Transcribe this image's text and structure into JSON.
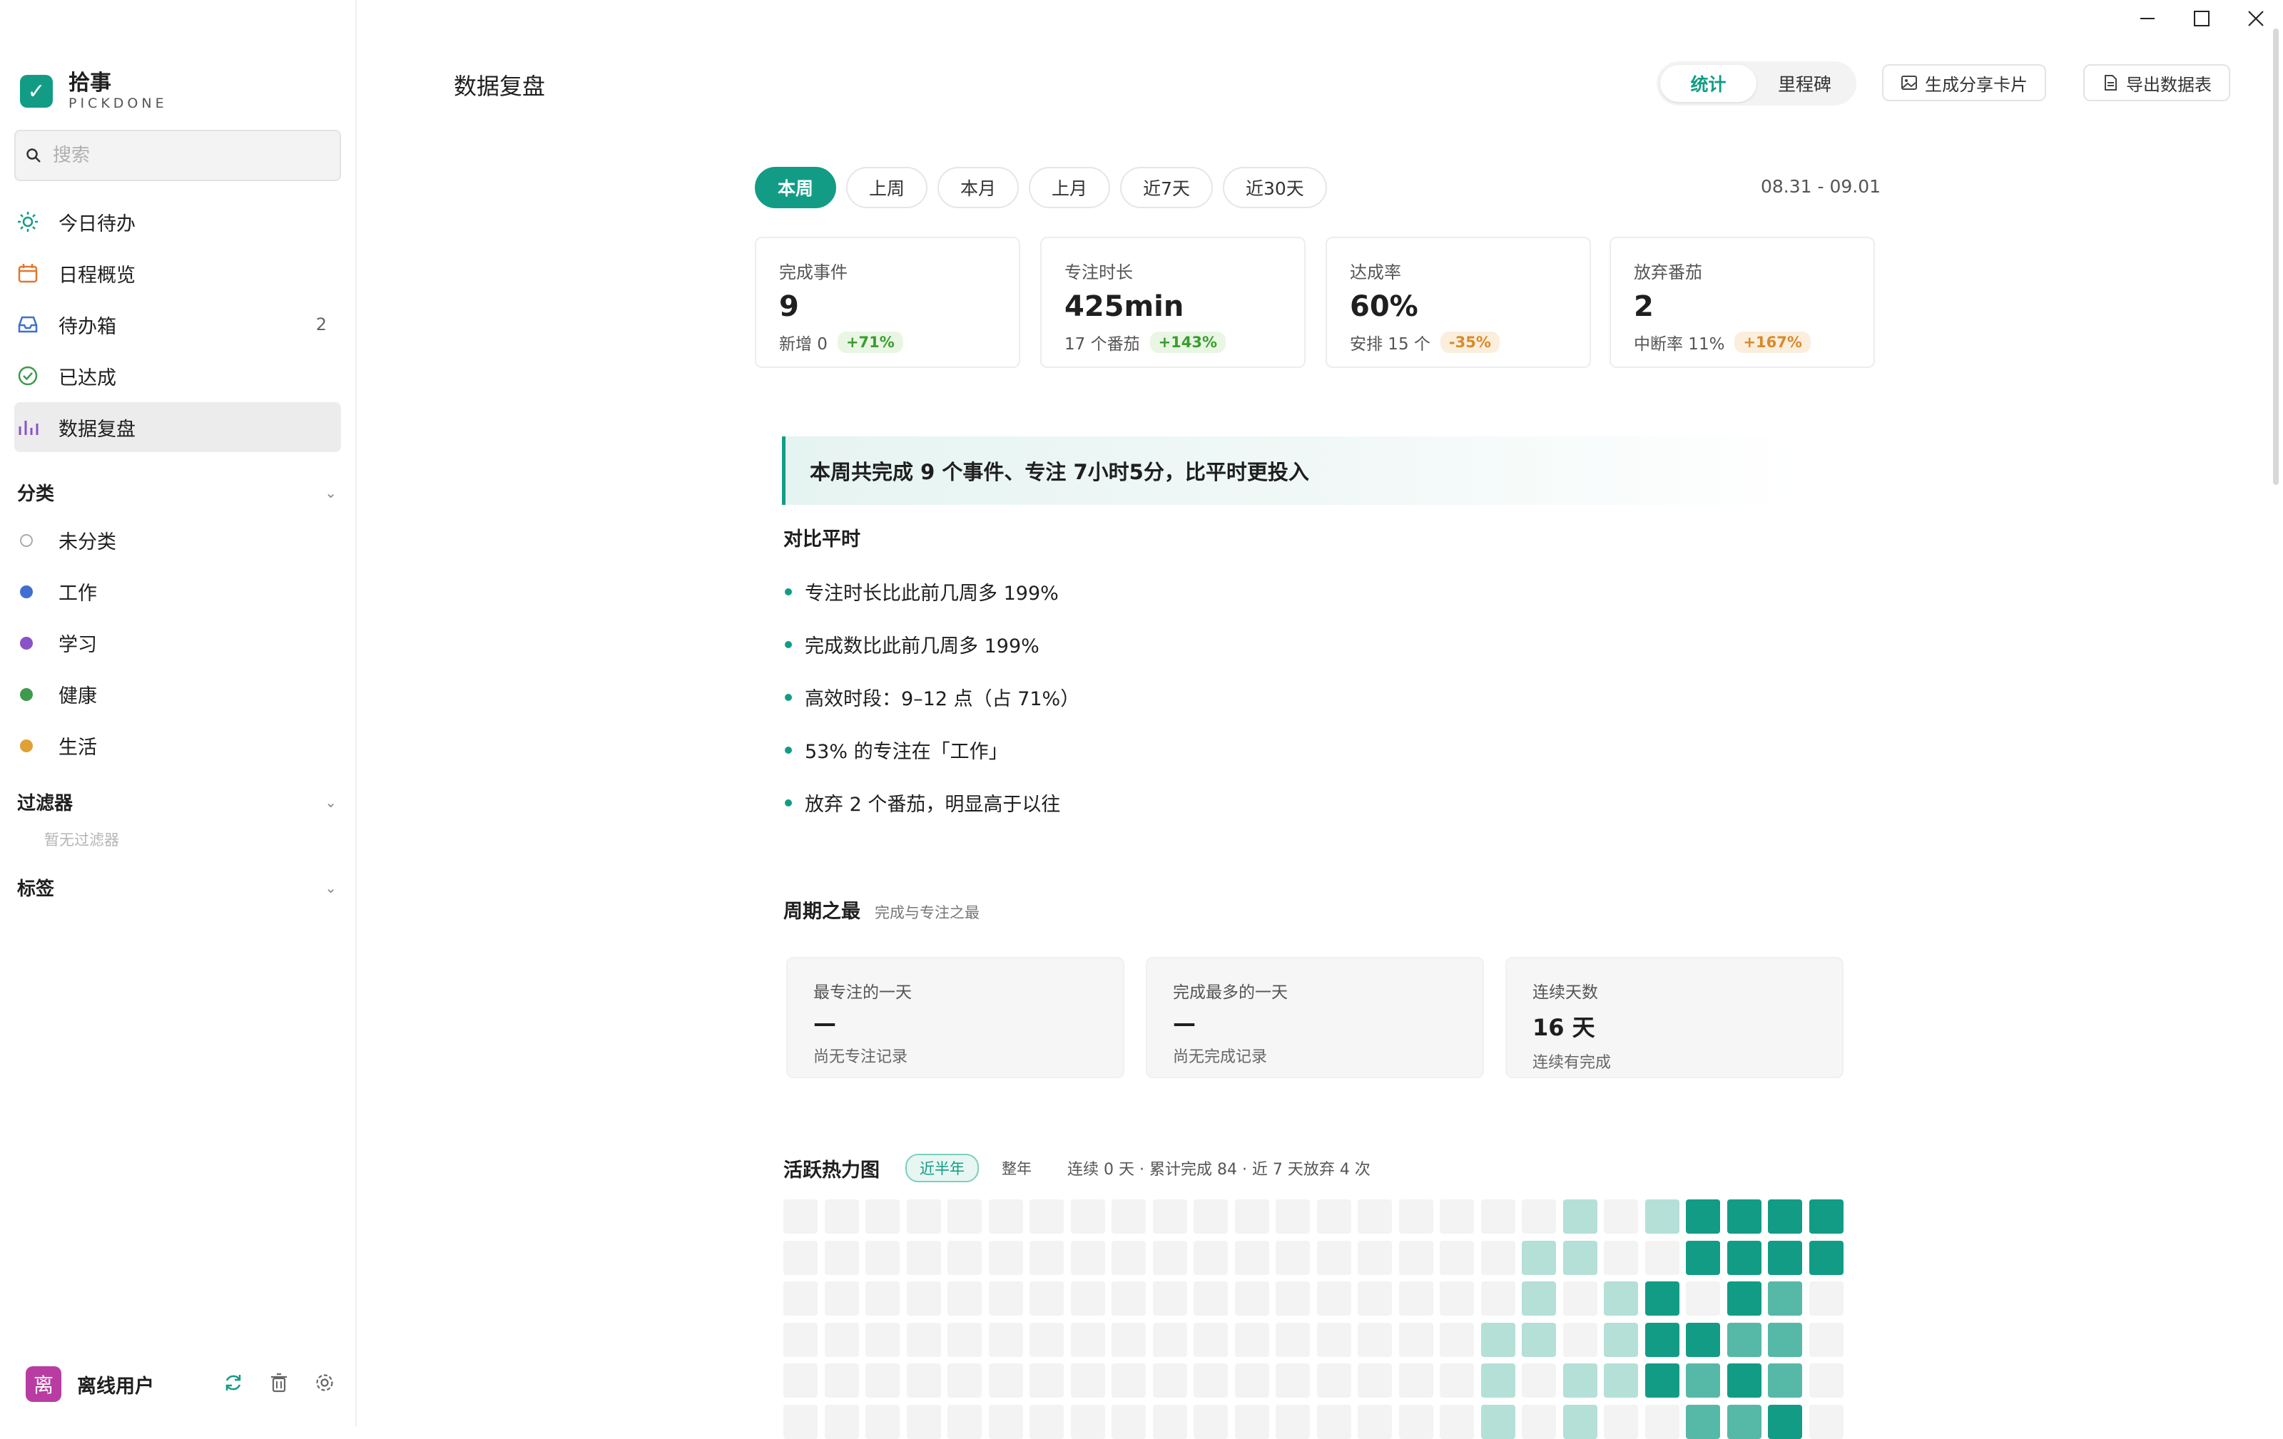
{
  "app": {
    "name": "拾事",
    "subtitle": "PICKDONE"
  },
  "sidebar": {
    "search_placeholder": "搜索",
    "nav": [
      {
        "label": "今日待办",
        "icon": "sun-icon"
      },
      {
        "label": "日程概览",
        "icon": "calendar-icon"
      },
      {
        "label": "待办箱",
        "icon": "inbox-icon",
        "count": "2"
      },
      {
        "label": "已达成",
        "icon": "check-circle-icon"
      },
      {
        "label": "数据复盘",
        "icon": "bar-chart-icon",
        "active": true
      }
    ],
    "categories_title": "分类",
    "categories": [
      {
        "label": "未分类",
        "color": "#ffffff"
      },
      {
        "label": "工作",
        "color": "#3f6fd1"
      },
      {
        "label": "学习",
        "color": "#8a52c9"
      },
      {
        "label": "健康",
        "color": "#3e9a4d"
      },
      {
        "label": "生活",
        "color": "#e0a134"
      }
    ],
    "filters_title": "过滤器",
    "filters_empty": "暂无过滤器",
    "tags_title": "标签",
    "user": {
      "avatar_text": "离",
      "name": "离线用户"
    }
  },
  "header": {
    "title": "数据复盘",
    "toggle": [
      {
        "label": "统计",
        "active": true
      },
      {
        "label": "里程碑",
        "active": false
      }
    ],
    "share_label": "生成分享卡片",
    "export_label": "导出数据表"
  },
  "periods": [
    {
      "label": "本周",
      "active": true
    },
    {
      "label": "上周"
    },
    {
      "label": "本月"
    },
    {
      "label": "上月"
    },
    {
      "label": "近7天"
    },
    {
      "label": "近30天"
    }
  ],
  "date_range": "08.31 - 09.01",
  "stats": [
    {
      "label": "完成事件",
      "value": "9",
      "sub": "新增 0",
      "delta": "+71%",
      "trend": "up"
    },
    {
      "label": "专注时长",
      "value": "425min",
      "sub": "17 个番茄",
      "delta": "+143%",
      "trend": "up"
    },
    {
      "label": "达成率",
      "value": "60%",
      "sub": "安排 15 个",
      "delta": "-35%",
      "trend": "down"
    },
    {
      "label": "放弃番茄",
      "value": "2",
      "sub": "中断率 11%",
      "delta": "+167%",
      "trend": "down"
    }
  ],
  "summary": "本周共完成 9 个事件、专注 7小时5分，比平时更投入",
  "compare": {
    "title": "对比平时",
    "items": [
      "专注时长比此前几周多 199%",
      "完成数比此前几周多 199%",
      "高效时段：9–12 点（占 71%）",
      "53% 的专注在「工作」",
      "放弃 2 个番茄，明显高于以往"
    ]
  },
  "best": {
    "title": "周期之最",
    "subtitle": "完成与专注之最",
    "cards": [
      {
        "label": "最专注的一天",
        "value": "—",
        "sub": "尚无专注记录"
      },
      {
        "label": "完成最多的一天",
        "value": "—",
        "sub": "尚无完成记录"
      },
      {
        "label": "连续天数",
        "value": "16 天",
        "sub": "连续有完成"
      }
    ]
  },
  "heatmap": {
    "title": "活跃热力图",
    "chips": [
      {
        "label": "近半年",
        "active": true
      },
      {
        "label": "整年",
        "active": false
      }
    ],
    "meta": "连续 0 天 · 累计完成 84 · 近 7 天放弃 4 次",
    "colors": [
      "#f3f3f3",
      "#b4e0d8",
      "#56b8a6",
      "#129c86"
    ],
    "levels": [
      [
        0,
        0,
        0,
        0,
        0,
        0,
        0,
        0,
        0,
        0,
        0,
        0,
        0,
        0,
        0,
        0,
        0,
        0,
        0,
        1,
        0,
        1,
        3,
        3,
        3,
        3
      ],
      [
        0,
        0,
        0,
        0,
        0,
        0,
        0,
        0,
        0,
        0,
        0,
        0,
        0,
        0,
        0,
        0,
        0,
        0,
        1,
        1,
        0,
        0,
        3,
        3,
        3,
        3
      ],
      [
        0,
        0,
        0,
        0,
        0,
        0,
        0,
        0,
        0,
        0,
        0,
        0,
        0,
        0,
        0,
        0,
        0,
        0,
        1,
        0,
        1,
        3,
        0,
        3,
        2,
        0
      ],
      [
        0,
        0,
        0,
        0,
        0,
        0,
        0,
        0,
        0,
        0,
        0,
        0,
        0,
        0,
        0,
        0,
        0,
        1,
        1,
        0,
        1,
        3,
        3,
        2,
        2,
        0
      ],
      [
        0,
        0,
        0,
        0,
        0,
        0,
        0,
        0,
        0,
        0,
        0,
        0,
        0,
        0,
        0,
        0,
        0,
        1,
        0,
        1,
        1,
        3,
        2,
        3,
        2,
        0
      ],
      [
        0,
        0,
        0,
        0,
        0,
        0,
        0,
        0,
        0,
        0,
        0,
        0,
        0,
        0,
        0,
        0,
        0,
        1,
        0,
        1,
        0,
        0,
        2,
        2,
        3,
        0
      ]
    ]
  }
}
